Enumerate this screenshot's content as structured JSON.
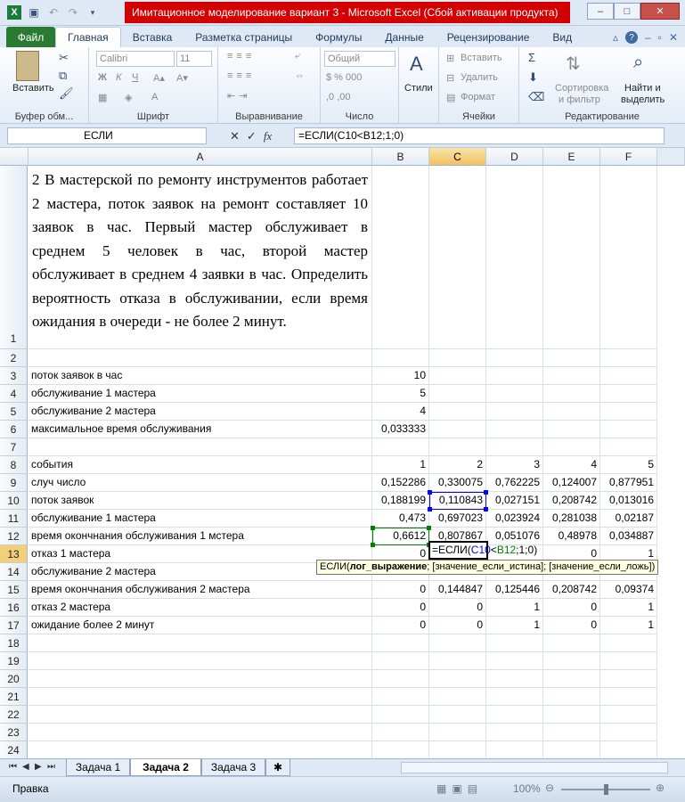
{
  "window": {
    "title": "Имитационное моделирование вариант 3  -  Microsoft Excel (Сбой активации продукта)"
  },
  "ribbon_tabs": [
    "Файл",
    "Главная",
    "Вставка",
    "Разметка страницы",
    "Формулы",
    "Данные",
    "Рецензирование",
    "Вид"
  ],
  "ribbon": {
    "paste_label": "Вставить",
    "clipboard_group": "Буфер обм...",
    "font_name": "Calibri",
    "font_size": "11",
    "font_group": "Шрифт",
    "align_group": "Выравнивание",
    "number_format": "Общий",
    "number_group": "Число",
    "styles_label": "Стили",
    "insert_label": "Вставить",
    "delete_label": "Удалить",
    "format_label": "Формат",
    "cells_group": "Ячейки",
    "sort_label": "Сортировка",
    "sort_label2": "и фильтр",
    "find_label": "Найти и",
    "find_label2": "выделить",
    "editing_group": "Редактирование"
  },
  "formula_bar": {
    "name_box": "ЕСЛИ",
    "formula": "=ЕСЛИ(C10<B12;1;0)"
  },
  "columns": [
    "A",
    "B",
    "C",
    "D",
    "E",
    "F"
  ],
  "rows": [
    "1",
    "2",
    "3",
    "4",
    "5",
    "6",
    "7",
    "8",
    "9",
    "10",
    "11",
    "12",
    "13",
    "14",
    "15",
    "16",
    "17",
    "18",
    "19",
    "20",
    "21",
    "22",
    "23",
    "24"
  ],
  "problem_text": "2 В мастерской по ремонту инструментов работает 2 мастера, поток заявок на ремонт составляет 10 заявок в час. Первый мастер обслуживает в среднем 5 человек в час, второй мастер обслуживает в среднем 4 заявки в час. Определить вероятность отказа в обслуживании, если время ожидания в очереди - не более 2 минут.",
  "table": [
    {
      "label": "поток заявок в час",
      "values": [
        "10",
        "",
        "",
        "",
        ""
      ]
    },
    {
      "label": "обслуживание 1 мастера",
      "values": [
        "5",
        "",
        "",
        "",
        ""
      ]
    },
    {
      "label": "обслуживание 2 мастера",
      "values": [
        "4",
        "",
        "",
        "",
        ""
      ]
    },
    {
      "label": "максимальное время обслуживания",
      "values": [
        "0,033333",
        "",
        "",
        "",
        ""
      ]
    },
    {
      "label": "",
      "values": [
        "",
        "",
        "",
        "",
        ""
      ]
    },
    {
      "label": "события",
      "values": [
        "1",
        "2",
        "3",
        "4",
        "5"
      ]
    },
    {
      "label": "случ число",
      "values": [
        "0,152286",
        "0,330075",
        "0,762225",
        "0,124007",
        "0,877951"
      ]
    },
    {
      "label": "поток заявок",
      "values": [
        "0,188199",
        "0,110843",
        "0,027151",
        "0,208742",
        "0,013016"
      ]
    },
    {
      "label": "обслуживание 1 мастера",
      "values": [
        "0,473",
        "0,697023",
        "0,023924",
        "0,281038",
        "0,02187"
      ]
    },
    {
      "label": "время окончнания обслуживания 1 мстера",
      "values": [
        "0,6612",
        "0,807867",
        "0,051076",
        "0,48978",
        "0,034887"
      ]
    },
    {
      "label": "отказ 1 мастера",
      "values": [
        "0",
        "",
        "",
        "0",
        "1"
      ]
    },
    {
      "label": "обслуживание 2 мастера",
      "values": [
        "",
        "",
        "",
        "",
        ""
      ]
    },
    {
      "label": "время окончнания обслуживания 2 мастера",
      "values": [
        "0",
        "0,144847",
        "0,125446",
        "0,208742",
        "0,09374"
      ]
    },
    {
      "label": "отказ 2 мастера",
      "values": [
        "0",
        "0",
        "1",
        "0",
        "1"
      ]
    },
    {
      "label": "ожидание более 2 минут",
      "values": [
        "0",
        "0",
        "1",
        "0",
        "1"
      ]
    }
  ],
  "edit_cell": {
    "p1": "=ЕСЛИ(",
    "ref1": "C10",
    "op": "<",
    "ref2": "B12",
    "tail": ";1;0)"
  },
  "tooltip": {
    "fn": "ЕСЛИ(",
    "arg1": "лог_выражение",
    "rest": "; [значение_если_истина]; [значение_если_ложь])"
  },
  "sheets": [
    "Задача 1",
    "Задача 2",
    "Задача 3"
  ],
  "status": {
    "mode": "Правка",
    "zoom": "100%"
  },
  "colors": {
    "title_bg": "#d40000",
    "file_tab": "#2b7a31",
    "ref1": "#0000ff",
    "ref2": "#008000"
  }
}
